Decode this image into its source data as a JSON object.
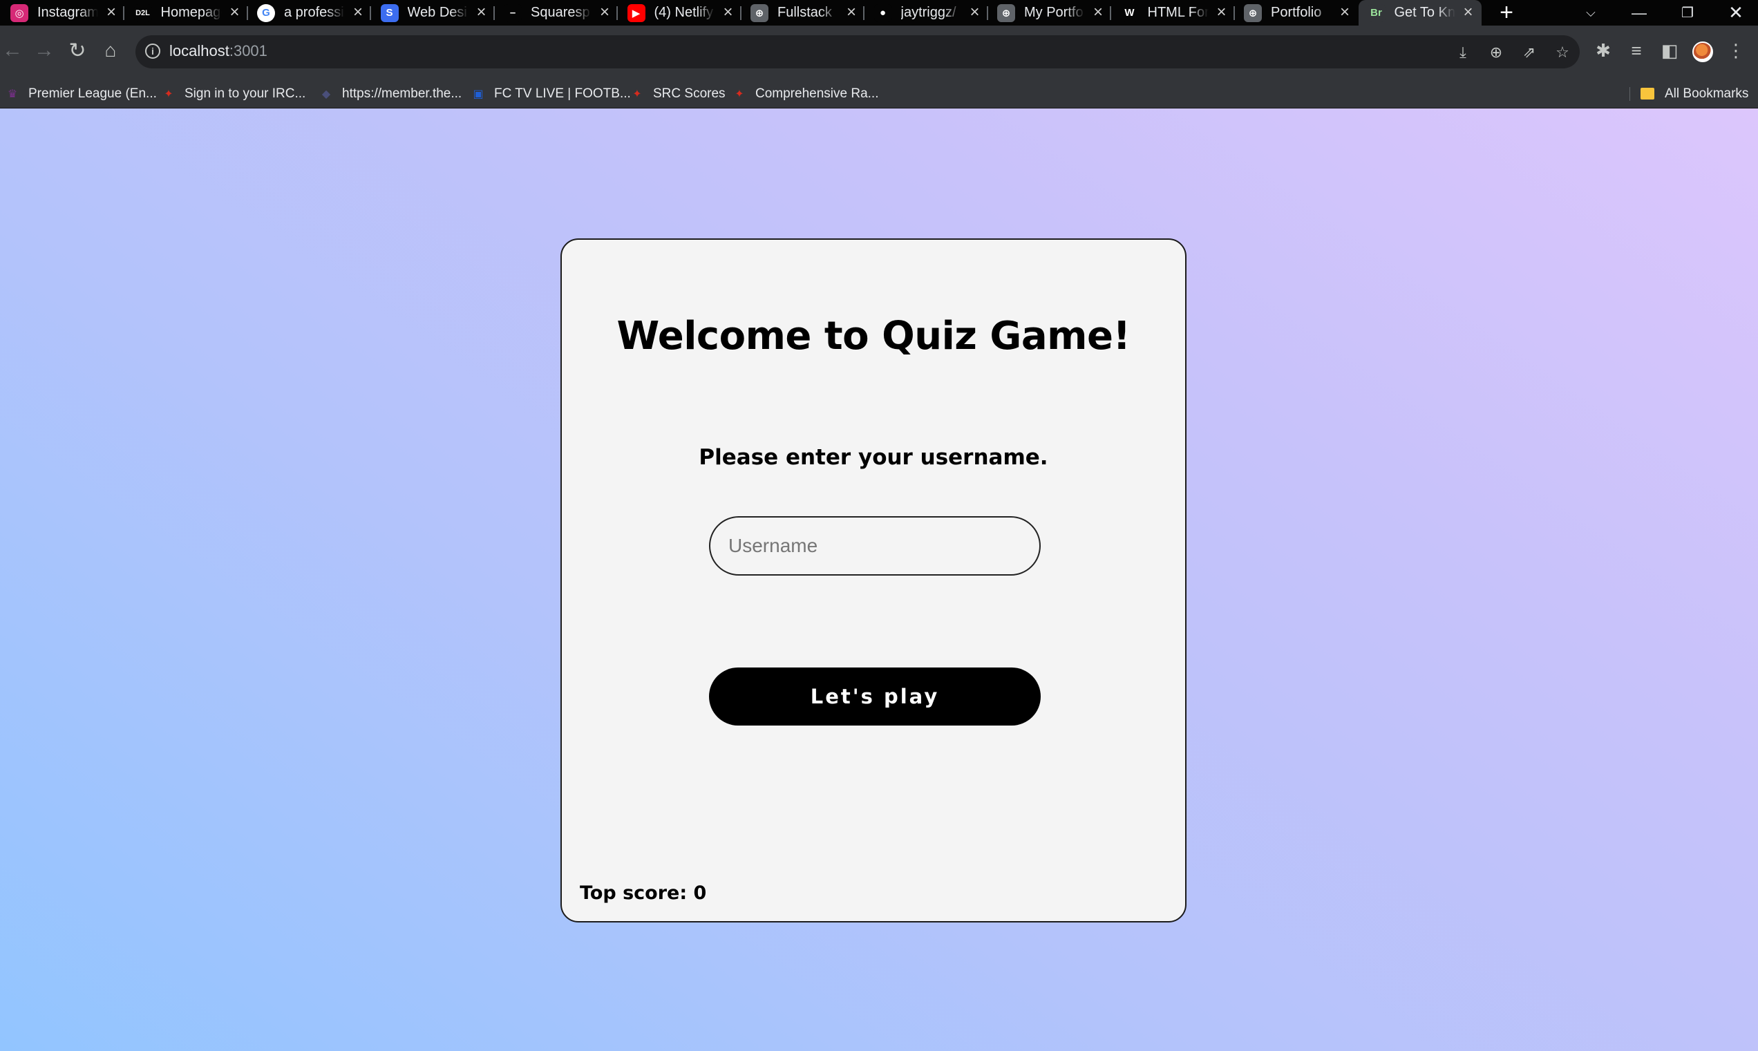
{
  "browser": {
    "tabs": [
      {
        "title": "Instagram",
        "icon": "instagram-icon",
        "color": "#d62976",
        "glyph": "◎"
      },
      {
        "title": "Homepage",
        "icon": "d2l-icon",
        "color": "#050505",
        "glyph": "D2L"
      },
      {
        "title": "a professi",
        "icon": "google-icon",
        "color": "#ffffff",
        "glyph": "G"
      },
      {
        "title": "Web Desi",
        "icon": "s-icon",
        "color": "#3c6df0",
        "glyph": "S"
      },
      {
        "title": "Squaresp",
        "icon": "squarespace-icon",
        "color": "#050505",
        "glyph": "–"
      },
      {
        "title": "(4) Netlify",
        "icon": "youtube-icon",
        "color": "#ff0000",
        "glyph": "▶"
      },
      {
        "title": "Fullstack",
        "icon": "globe-icon",
        "color": "#5f6368",
        "glyph": "⊕"
      },
      {
        "title": "jaytriggz/",
        "icon": "github-icon",
        "color": "#050505",
        "glyph": "●"
      },
      {
        "title": "My Portfo",
        "icon": "globe-icon",
        "color": "#5f6368",
        "glyph": "⊕"
      },
      {
        "title": "HTML For",
        "icon": "w-icon",
        "color": "#050505",
        "glyph": "W"
      },
      {
        "title": "Portfolio",
        "icon": "globe-icon",
        "color": "#5f6368",
        "glyph": "⊕"
      },
      {
        "title": "Get To Kn",
        "icon": "bootstrap-icon",
        "color": "#333539",
        "glyph": "Br"
      }
    ],
    "active_tab_index": 11,
    "url_host": "localhost",
    "url_port": ":3001",
    "bookmarks": [
      {
        "label": "Premier League (En...",
        "icon": "premier-league-icon"
      },
      {
        "label": "Sign in to your IRC...",
        "icon": "maple-leaf-icon"
      },
      {
        "label": "https://member.the...",
        "icon": "site-icon"
      },
      {
        "label": "FC TV LIVE | FOOTB...",
        "icon": "fctv-icon"
      },
      {
        "label": "SRC Scores",
        "icon": "maple-leaf-icon"
      },
      {
        "label": "Comprehensive Ra...",
        "icon": "maple-leaf-icon"
      }
    ],
    "all_bookmarks_label": "All Bookmarks"
  },
  "page": {
    "title": "Welcome to Quiz Game!",
    "prompt": "Please enter your username.",
    "username_placeholder": "Username",
    "username_value": "",
    "play_button": "Let's play",
    "top_score_label": "Top score: 0"
  }
}
